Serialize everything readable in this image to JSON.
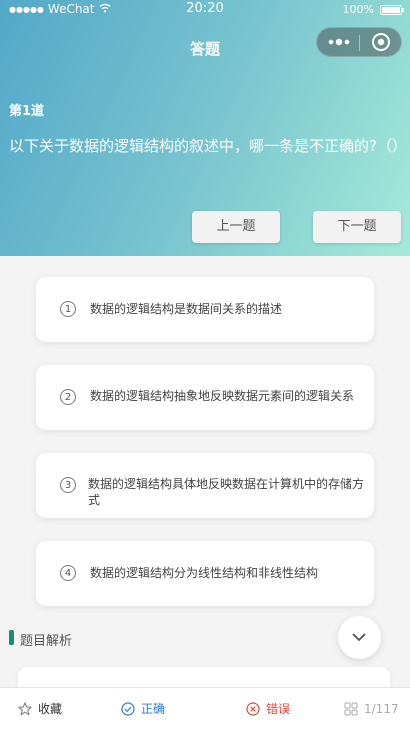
{
  "status": {
    "signal": "●●●●●",
    "carrier": "WeChat",
    "time": "20:20",
    "battery": "100%"
  },
  "nav": {
    "title": "答题"
  },
  "question": {
    "number": "第1道",
    "text": "以下关于数据的逻辑结构的叙述中，哪一条是不正确的?（）"
  },
  "buttons": {
    "prev": "上一题",
    "next": "下一题"
  },
  "options": [
    {
      "badge": "1",
      "text": "数据的逻辑结构是数据间关系的描述"
    },
    {
      "badge": "2",
      "text": "数据的逻辑结构抽象地反映数据元素间的逻辑关系"
    },
    {
      "badge": "3",
      "text": "数据的逻辑结构具体地反映数据在计算机中的存储方式"
    },
    {
      "badge": "4",
      "text": "数据的逻辑结构分为线性结构和非线性结构"
    }
  ],
  "analysis": {
    "label": "题目解析"
  },
  "bottom": {
    "favorite": "收藏",
    "correct": "正确",
    "wrong": "错误",
    "progress": "1/117"
  },
  "colors": {
    "accent_green": "#1f8a74",
    "correct_blue": "#2d7be0",
    "wrong_red": "#e04a3f"
  }
}
